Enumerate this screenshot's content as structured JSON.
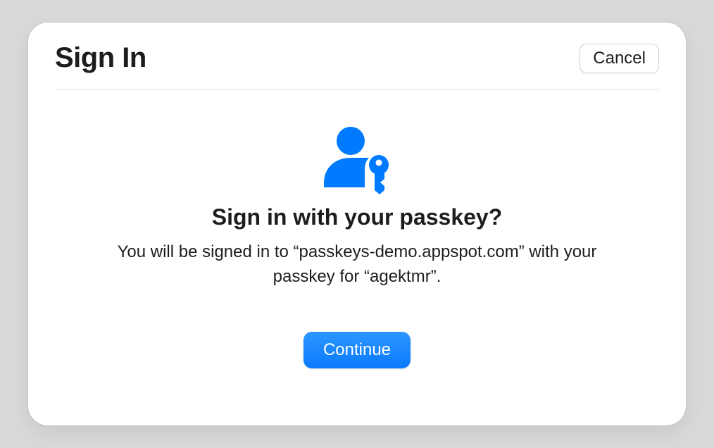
{
  "dialog": {
    "title": "Sign In",
    "cancel_label": "Cancel",
    "prompt_title": "Sign in with your passkey?",
    "prompt_desc": "You will be signed in to “passkeys-demo.appspot.com” with your passkey for “agektmr”.",
    "continue_label": "Continue",
    "accent_color": "#007aff"
  }
}
